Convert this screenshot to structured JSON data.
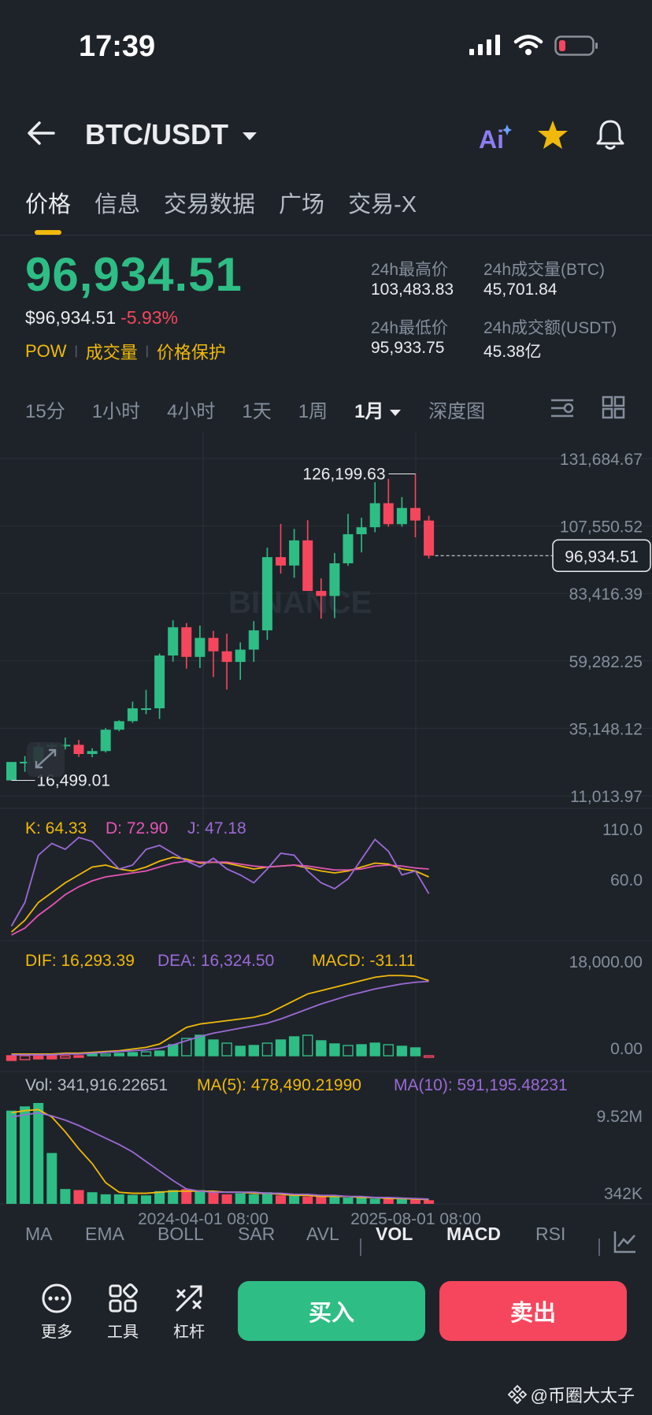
{
  "status": {
    "time": "17:39"
  },
  "header": {
    "pair": "BTC/USDT"
  },
  "tabs": [
    "价格",
    "信息",
    "交易数据",
    "广场",
    "交易-X"
  ],
  "price": {
    "last": "96,934.51",
    "usd": "$96,934.51",
    "change": "-5.93%",
    "tags": [
      "POW",
      "成交量",
      "价格保护"
    ]
  },
  "stats": {
    "high_label": "24h最高价",
    "high": "103,483.83",
    "vol_btc_label": "24h成交量(BTC)",
    "vol_btc": "45,701.84",
    "low_label": "24h最低价",
    "low": "95,933.75",
    "vol_usdt_label": "24h成交额(USDT)",
    "vol_usdt": "45.38亿"
  },
  "intervals": [
    "15分",
    "1小时",
    "4小时",
    "1天",
    "1周",
    "1月",
    "深度图"
  ],
  "chart_data": {
    "type": "candlestick",
    "watermark": "BINANCE",
    "y_ticks": [
      "131,684.67",
      "107,550.52",
      "83,416.39",
      "59,282.25",
      "35,148.12",
      "11,013.97"
    ],
    "ylim": [
      11013.97,
      131684.67
    ],
    "current_price_label": "96,934.51",
    "max_label": "126,199.63",
    "min_label": "16,499.01",
    "x_ticks": [
      "2024-04-01 08:00",
      "2025-08-01 08:00"
    ],
    "candles": [
      {
        "o": 16500,
        "h": 23000,
        "l": 16499,
        "c": 23100
      },
      {
        "o": 23100,
        "h": 25200,
        "l": 19600,
        "c": 23150
      },
      {
        "o": 23150,
        "h": 30000,
        "l": 21300,
        "c": 28500
      },
      {
        "o": 28500,
        "h": 30000,
        "l": 26900,
        "c": 29250
      },
      {
        "o": 29250,
        "h": 31800,
        "l": 27600,
        "c": 29250
      },
      {
        "o": 29250,
        "h": 31000,
        "l": 24900,
        "c": 25950
      },
      {
        "o": 25950,
        "h": 28000,
        "l": 24800,
        "c": 27000
      },
      {
        "o": 27000,
        "h": 35200,
        "l": 26500,
        "c": 34650
      },
      {
        "o": 34650,
        "h": 38000,
        "l": 34100,
        "c": 37700
      },
      {
        "o": 37700,
        "h": 44700,
        "l": 37100,
        "c": 42300
      },
      {
        "o": 42300,
        "h": 48900,
        "l": 40200,
        "c": 42300
      },
      {
        "o": 42300,
        "h": 61900,
        "l": 38500,
        "c": 61200
      },
      {
        "o": 61200,
        "h": 73800,
        "l": 59000,
        "c": 71300
      },
      {
        "o": 71300,
        "h": 72800,
        "l": 56500,
        "c": 60700
      },
      {
        "o": 60700,
        "h": 71900,
        "l": 56700,
        "c": 67500
      },
      {
        "o": 67500,
        "h": 70000,
        "l": 53500,
        "c": 62700
      },
      {
        "o": 62700,
        "h": 69000,
        "l": 49000,
        "c": 58900
      },
      {
        "o": 58900,
        "h": 65900,
        "l": 52500,
        "c": 63300
      },
      {
        "o": 63300,
        "h": 73500,
        "l": 58900,
        "c": 70200
      },
      {
        "o": 70200,
        "h": 99800,
        "l": 66800,
        "c": 96400
      },
      {
        "o": 96400,
        "h": 108300,
        "l": 90500,
        "c": 93400
      },
      {
        "o": 93400,
        "h": 106500,
        "l": 89000,
        "c": 102400
      },
      {
        "o": 102400,
        "h": 109600,
        "l": 91200,
        "c": 84300
      },
      {
        "o": 84300,
        "h": 88800,
        "l": 74400,
        "c": 82500
      },
      {
        "o": 82500,
        "h": 97900,
        "l": 74600,
        "c": 94200
      },
      {
        "o": 94200,
        "h": 111900,
        "l": 93300,
        "c": 104600
      },
      {
        "o": 104600,
        "h": 110500,
        "l": 98100,
        "c": 107100
      },
      {
        "o": 107100,
        "h": 123200,
        "l": 105300,
        "c": 115700
      },
      {
        "o": 115700,
        "h": 124400,
        "l": 107300,
        "c": 108200
      },
      {
        "o": 108200,
        "h": 117900,
        "l": 107300,
        "c": 114000
      },
      {
        "o": 114000,
        "h": 126199,
        "l": 103500,
        "c": 109500
      },
      {
        "o": 109500,
        "h": 111200,
        "l": 95900,
        "c": 96934
      }
    ],
    "kdj": {
      "k": "K: 64.33",
      "d": "D: 72.90",
      "j": "J: 47.18",
      "ticks": [
        "110.0",
        "60.0"
      ]
    },
    "macd": {
      "dif": "DIF: 16,293.39",
      "dea": "DEA: 16,324.50",
      "macd": "MACD: -31.11",
      "ticks": [
        "18,000.00",
        "0.00"
      ]
    },
    "volume": {
      "vol": "Vol: 341,916.22651",
      "ma5": "MA(5): 478,490.21990",
      "ma10": "MA(10): 591,195.48231",
      "ticks": [
        "9.52M",
        "342K"
      ],
      "values": [
        8.8,
        9.2,
        9.52,
        4.8,
        1.4,
        1.3,
        1.1,
        0.9,
        0.9,
        0.85,
        0.8,
        1.2,
        1.3,
        1.4,
        1.3,
        1.1,
        0.9,
        1.0,
        0.9,
        1.1,
        0.8,
        0.8,
        0.7,
        0.8,
        0.7,
        0.6,
        0.6,
        0.5,
        0.5,
        0.45,
        0.4,
        0.342
      ]
    }
  },
  "indicators": [
    "MA",
    "EMA",
    "BOLL",
    "SAR",
    "AVL",
    "VOL",
    "MACD",
    "RSI"
  ],
  "actions": {
    "more": "更多",
    "tools": "工具",
    "leverage": "杠杆",
    "buy": "买入",
    "sell": "卖出"
  },
  "watermark": "@币圈大太子",
  "colors": {
    "up": "#2ebd85",
    "down": "#f6465d",
    "accent": "#f0b90b",
    "bg": "#1e2329"
  }
}
